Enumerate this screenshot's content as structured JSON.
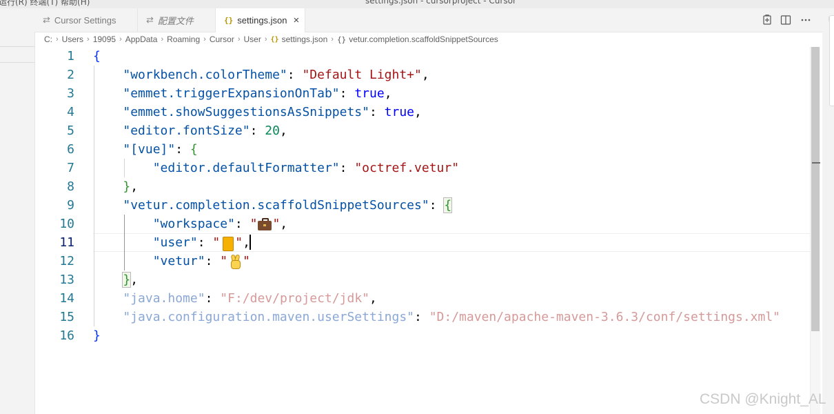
{
  "titlebar": {
    "left_fragment": "运行(R)  终端(T)  帮助(H)",
    "center_fragment": "settings.json - cursorproject - Cursor"
  },
  "tabs": [
    {
      "label": "Cursor Settings",
      "icon": "settings-sliders-icon",
      "active": false
    },
    {
      "label": "配置文件",
      "icon": "settings-sliders-icon",
      "active": false,
      "italic": true
    },
    {
      "label": "settings.json",
      "icon": "json-braces-icon",
      "active": true
    }
  ],
  "tab_close_symbol": "×",
  "tab_actions": [
    "open-changes-icon",
    "split-editor-icon"
  ],
  "breadcrumb": {
    "segments": [
      "C:",
      "Users",
      "19095",
      "AppData",
      "Roaming",
      "Cursor",
      "User"
    ],
    "file": "settings.json",
    "file_icon": "{}",
    "symbol_icon": "{}",
    "symbol": "vetur.completion.scaffoldSnippetSources",
    "separator": "›"
  },
  "editor": {
    "line_numbers": [
      "1",
      "2",
      "3",
      "4",
      "5",
      "6",
      "7",
      "8",
      "9",
      "10",
      "11",
      "12",
      "13",
      "14",
      "15",
      "16"
    ],
    "current_line": 11,
    "code": {
      "l1_open": "{",
      "l2_key": "\"workbench.colorTheme\"",
      "l2_val": "\"Default Light+\"",
      "l3_key": "\"emmet.triggerExpansionOnTab\"",
      "l3_val": "true",
      "l4_key": "\"emmet.showSuggestionsAsSnippets\"",
      "l4_val": "true",
      "l5_key": "\"editor.fontSize\"",
      "l5_val": "20",
      "l6_key": "\"[vue]\"",
      "l6_open": "{",
      "l7_key": "\"editor.defaultFormatter\"",
      "l7_val": "\"octref.vetur\"",
      "l8_close": "}",
      "l9_key": "\"vetur.completion.scaffoldSnippetSources\"",
      "l9_open": "{",
      "l10_key": "\"workspace\"",
      "l11_key": "\"user\"",
      "l12_key": "\"vetur\"",
      "l13_close": "}",
      "l14_key": "\"java.home\"",
      "l14_val": "\"F:/dev/project/jdk\"",
      "l15_key": "\"java.configuration.maven.userSettings\"",
      "l15_val": "\"D:/maven/apache-maven-3.6.3/conf/settings.xml\"",
      "l16_close": "}",
      "quote": "\"",
      "colon": ": ",
      "comma": ","
    },
    "emoji": {
      "workspace": "briefcase-icon",
      "user": "folder-icon",
      "vetur": "victory-hand-icon"
    }
  },
  "watermark": "CSDN @Knight_AL",
  "colors": {
    "key": "#0451a5",
    "string": "#a31515",
    "number": "#098658",
    "boolean": "#0000ff",
    "line_number": "#237893",
    "json_icon": "#b89500"
  }
}
